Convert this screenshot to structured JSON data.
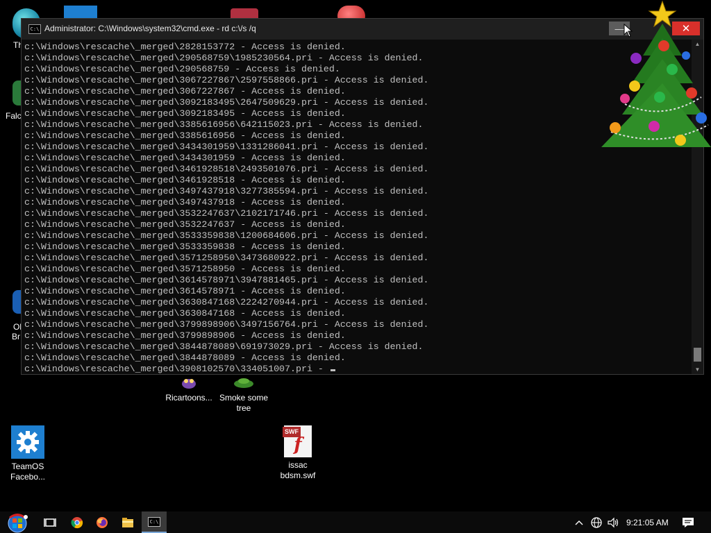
{
  "window": {
    "title": "Administrator: C:\\Windows\\system32\\cmd.exe - rd  c:\\/s /q",
    "icon_label": "C:\\",
    "minimize_label": "—",
    "close_label": "✕"
  },
  "console": {
    "lines": [
      "c:\\Windows\\rescache\\_merged\\2828153772 - Access is denied.",
      "c:\\Windows\\rescache\\_merged\\290568759\\1985230564.pri - Access is denied.",
      "c:\\Windows\\rescache\\_merged\\290568759 - Access is denied.",
      "c:\\Windows\\rescache\\_merged\\3067227867\\2597558866.pri - Access is denied.",
      "c:\\Windows\\rescache\\_merged\\3067227867 - Access is denied.",
      "c:\\Windows\\rescache\\_merged\\3092183495\\2647509629.pri - Access is denied.",
      "c:\\Windows\\rescache\\_merged\\3092183495 - Access is denied.",
      "c:\\Windows\\rescache\\_merged\\3385616956\\642115023.pri - Access is denied.",
      "c:\\Windows\\rescache\\_merged\\3385616956 - Access is denied.",
      "c:\\Windows\\rescache\\_merged\\3434301959\\1331286041.pri - Access is denied.",
      "c:\\Windows\\rescache\\_merged\\3434301959 - Access is denied.",
      "c:\\Windows\\rescache\\_merged\\3461928518\\2493501076.pri - Access is denied.",
      "c:\\Windows\\rescache\\_merged\\3461928518 - Access is denied.",
      "c:\\Windows\\rescache\\_merged\\3497437918\\3277385594.pri - Access is denied.",
      "c:\\Windows\\rescache\\_merged\\3497437918 - Access is denied.",
      "c:\\Windows\\rescache\\_merged\\3532247637\\2102171746.pri - Access is denied.",
      "c:\\Windows\\rescache\\_merged\\3532247637 - Access is denied.",
      "c:\\Windows\\rescache\\_merged\\3533359838\\1200684606.pri - Access is denied.",
      "c:\\Windows\\rescache\\_merged\\3533359838 - Access is denied.",
      "c:\\Windows\\rescache\\_merged\\3571258950\\3473680922.pri - Access is denied.",
      "c:\\Windows\\rescache\\_merged\\3571258950 - Access is denied.",
      "c:\\Windows\\rescache\\_merged\\3614578971\\3947881465.pri - Access is denied.",
      "c:\\Windows\\rescache\\_merged\\3614578971 - Access is denied.",
      "c:\\Windows\\rescache\\_merged\\3630847168\\2224270944.pri - Access is denied.",
      "c:\\Windows\\rescache\\_merged\\3630847168 - Access is denied.",
      "c:\\Windows\\rescache\\_merged\\3799898906\\3497156764.pri - Access is denied.",
      "c:\\Windows\\rescache\\_merged\\3799898906 - Access is denied.",
      "c:\\Windows\\rescache\\_merged\\3844878089\\691973029.pri - Access is denied.",
      "c:\\Windows\\rescache\\_merged\\3844878089 - Access is denied.",
      "c:\\Windows\\rescache\\_merged\\3908102570\\334051007.pri - "
    ],
    "text_color": "#c0c0c0",
    "background": "#0c0c0c"
  },
  "desktop": {
    "icons": [
      {
        "id": "ricartoons",
        "label": "Ricartoons...",
        "icon": "cartoon-shortcut-icon"
      },
      {
        "id": "smoke",
        "label": "Smoke some tree",
        "icon": "plant-shortcut-icon"
      },
      {
        "id": "teamos",
        "label": "TeamOS Facebo...",
        "icon": "gear-icon"
      },
      {
        "id": "issac",
        "label": "issac bdsm.swf",
        "icon": "swf-file-icon",
        "badge": "SWF"
      }
    ],
    "partial_labels": {
      "the": "Th",
      "falc": "Falc",
      "ol": "Ol",
      "br": "Br"
    }
  },
  "taskbar": {
    "clock": "9:21:05 AM",
    "icons": [
      "start-orb-icon",
      "task-view-icon",
      "chrome-icon",
      "firefox-icon",
      "file-explorer-icon",
      "cmd-icon"
    ],
    "tray_icons": [
      "chevron-up-icon",
      "network-icon",
      "volume-icon",
      "notification-icon"
    ],
    "accent": "#7aa7d8"
  },
  "colors": {
    "close_button": "#d9302b",
    "title_bar": "#1f1f1f"
  }
}
